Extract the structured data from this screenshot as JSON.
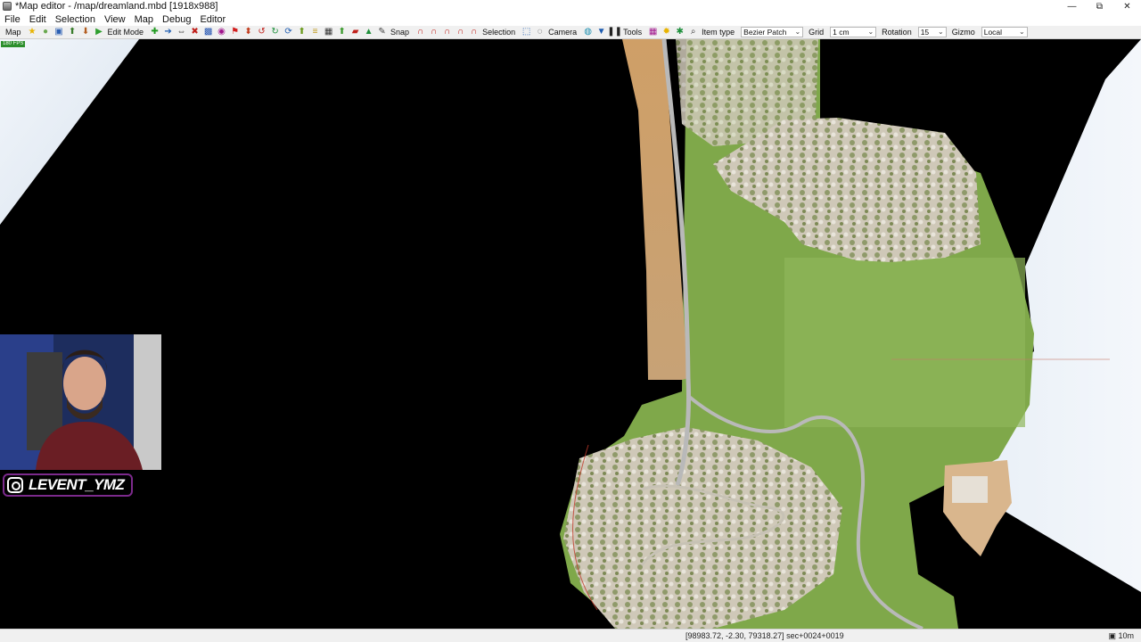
{
  "window": {
    "title": "*Map editor - /map/dreamland.mbd [1918x988]",
    "controls": {
      "minimize": "—",
      "restore": "⧉",
      "close": "✕"
    }
  },
  "menubar": {
    "items": [
      {
        "label": "File"
      },
      {
        "label": "Edit"
      },
      {
        "label": "Selection"
      },
      {
        "label": "View"
      },
      {
        "label": "Map"
      },
      {
        "label": "Debug"
      },
      {
        "label": "Editor"
      }
    ]
  },
  "toolbar": {
    "map_label": "Map",
    "edit_mode_label": "Edit Mode",
    "snap_label": "Snap",
    "selection_label": "Selection",
    "camera_label": "Camera",
    "tools_label": "Tools",
    "item_type_label": "Item type",
    "item_type_value": "Bezier Patch",
    "grid_label": "Grid",
    "grid_value": "1 cm",
    "rotation_label": "Rotation",
    "rotation_value": "15",
    "gizmo_label": "Gizmo",
    "gizmo_value": "Local"
  },
  "viewport": {
    "fps": "180 FPS"
  },
  "overlay": {
    "instagram_handle": "LEVENT_YMZ"
  },
  "statusbar": {
    "coordinates": "[98983.72, -2.30, 79318.27] sec+0024+0019",
    "scale": "▣ 10m"
  },
  "colors": {
    "grass": "#7fa84a",
    "sand_road": "#c9a06b",
    "rock": "#c9c2b3",
    "sky_plane": "#e6eef5",
    "instagram_border": "#7c2a8c"
  }
}
